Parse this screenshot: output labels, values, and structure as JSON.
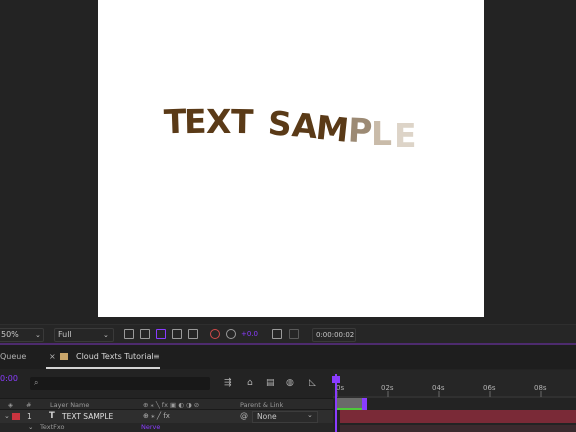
{
  "viewer": {
    "sample_text": "TEXT SAMPLE",
    "letters": [
      "T",
      "E",
      "X",
      "T",
      "S",
      "A",
      "M",
      "P",
      "L",
      "E"
    ],
    "letter_colors": [
      "#5a3a17",
      "#5a3a17",
      "#5a3a17",
      "#5a3a17",
      "#5a3a17",
      "#5a3a17",
      "#5a3a17",
      "#9c8a74",
      "#c9bba9",
      "#ddd4c8"
    ]
  },
  "toolbar": {
    "zoom": "50%",
    "resolution": "Full",
    "time": "0:00:00:02"
  },
  "tabs": {
    "render_queue": "Queue",
    "composition": "Cloud Texts Tutorial",
    "composition_color": "#c9a66b"
  },
  "timeline": {
    "current_time": "0:00",
    "ruler_ticks": [
      "0s",
      "02s",
      "04s",
      "06s",
      "08s"
    ],
    "columns": {
      "layer_name": "Layer Name",
      "parent_link": "Parent & Link"
    },
    "layer": {
      "number": "1",
      "type_glyph": "T",
      "name": "TEXT SAMPLE",
      "parent": "None",
      "label_color": "#c8343f"
    },
    "sub_item": "TextFxo",
    "sub_value": "Nerve"
  },
  "colors": {
    "accent": "#8a3cff",
    "layer_bar": "#7a2a37",
    "work_area": "#6a6a6a",
    "green_range": "#4ec93b"
  }
}
